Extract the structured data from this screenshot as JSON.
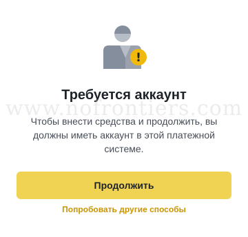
{
  "dialog": {
    "title": "Требуется аккаунт",
    "description": "Чтобы внести средства и продолжить, вы должны иметь аккаунт в этой платежной системе.",
    "continue_label": "Продолжить",
    "alt_link_label": "Попробовать другие способы"
  },
  "illustration": {
    "icon": "user-warning-icon",
    "badge_icon": "exclamation-icon",
    "badge_glyph": "!",
    "colors": {
      "figure": "#848e9c",
      "figure_light": "#b7bdc6",
      "badge": "#f0b90b"
    }
  },
  "watermark": {
    "text": "www.nofrontiers.com"
  },
  "colors": {
    "primary_button": "#f0d353",
    "link": "#c99400",
    "title": "#1e2329",
    "text": "#474d57"
  }
}
